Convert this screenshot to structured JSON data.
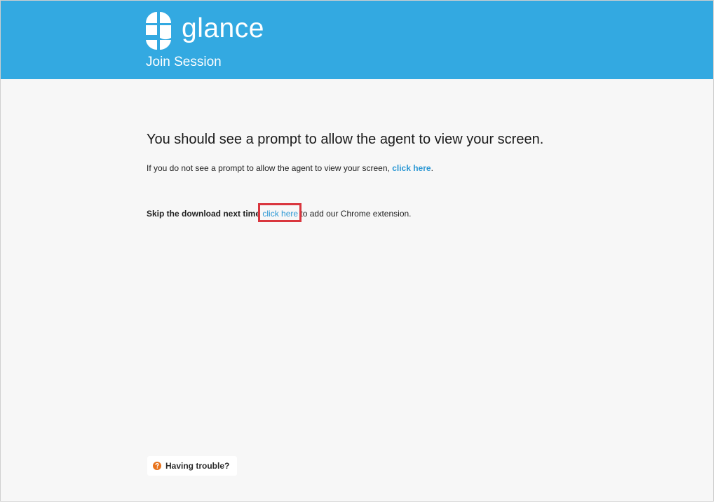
{
  "header": {
    "brand_name": "glance",
    "subtitle": "Join Session",
    "logo_icon": "glance-logo-icon",
    "background_color": "#33a9e1"
  },
  "main": {
    "headline": "You should see a prompt to allow the agent to view your screen.",
    "info_text": "If you do not see a prompt to allow the agent to view your screen, ",
    "info_link": "click here",
    "info_suffix": ".",
    "skip_lead": "Skip the download next time",
    "skip_link": "click here",
    "skip_suffix": "to add our Chrome extension.",
    "link_color": "#2a97d4",
    "highlight_color": "#d9363e"
  },
  "help": {
    "label": "Having trouble?",
    "icon": "question-circle-icon",
    "icon_color": "#e8731c"
  }
}
